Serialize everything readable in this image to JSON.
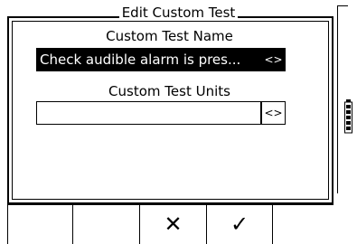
{
  "dialog": {
    "title": "Edit Custom Test",
    "name_label": "Custom Test Name",
    "name_value": "Check audible alarm is pres...",
    "name_nav": "<>",
    "units_label": "Custom Test Units",
    "units_value": "",
    "units_nav": "<>"
  },
  "softkeys": {
    "cancel": "✕",
    "confirm": "✓"
  },
  "colors": {
    "background": "#ffffff",
    "foreground": "#000000",
    "selected_bg": "#000000",
    "selected_fg": "#ffffff"
  }
}
